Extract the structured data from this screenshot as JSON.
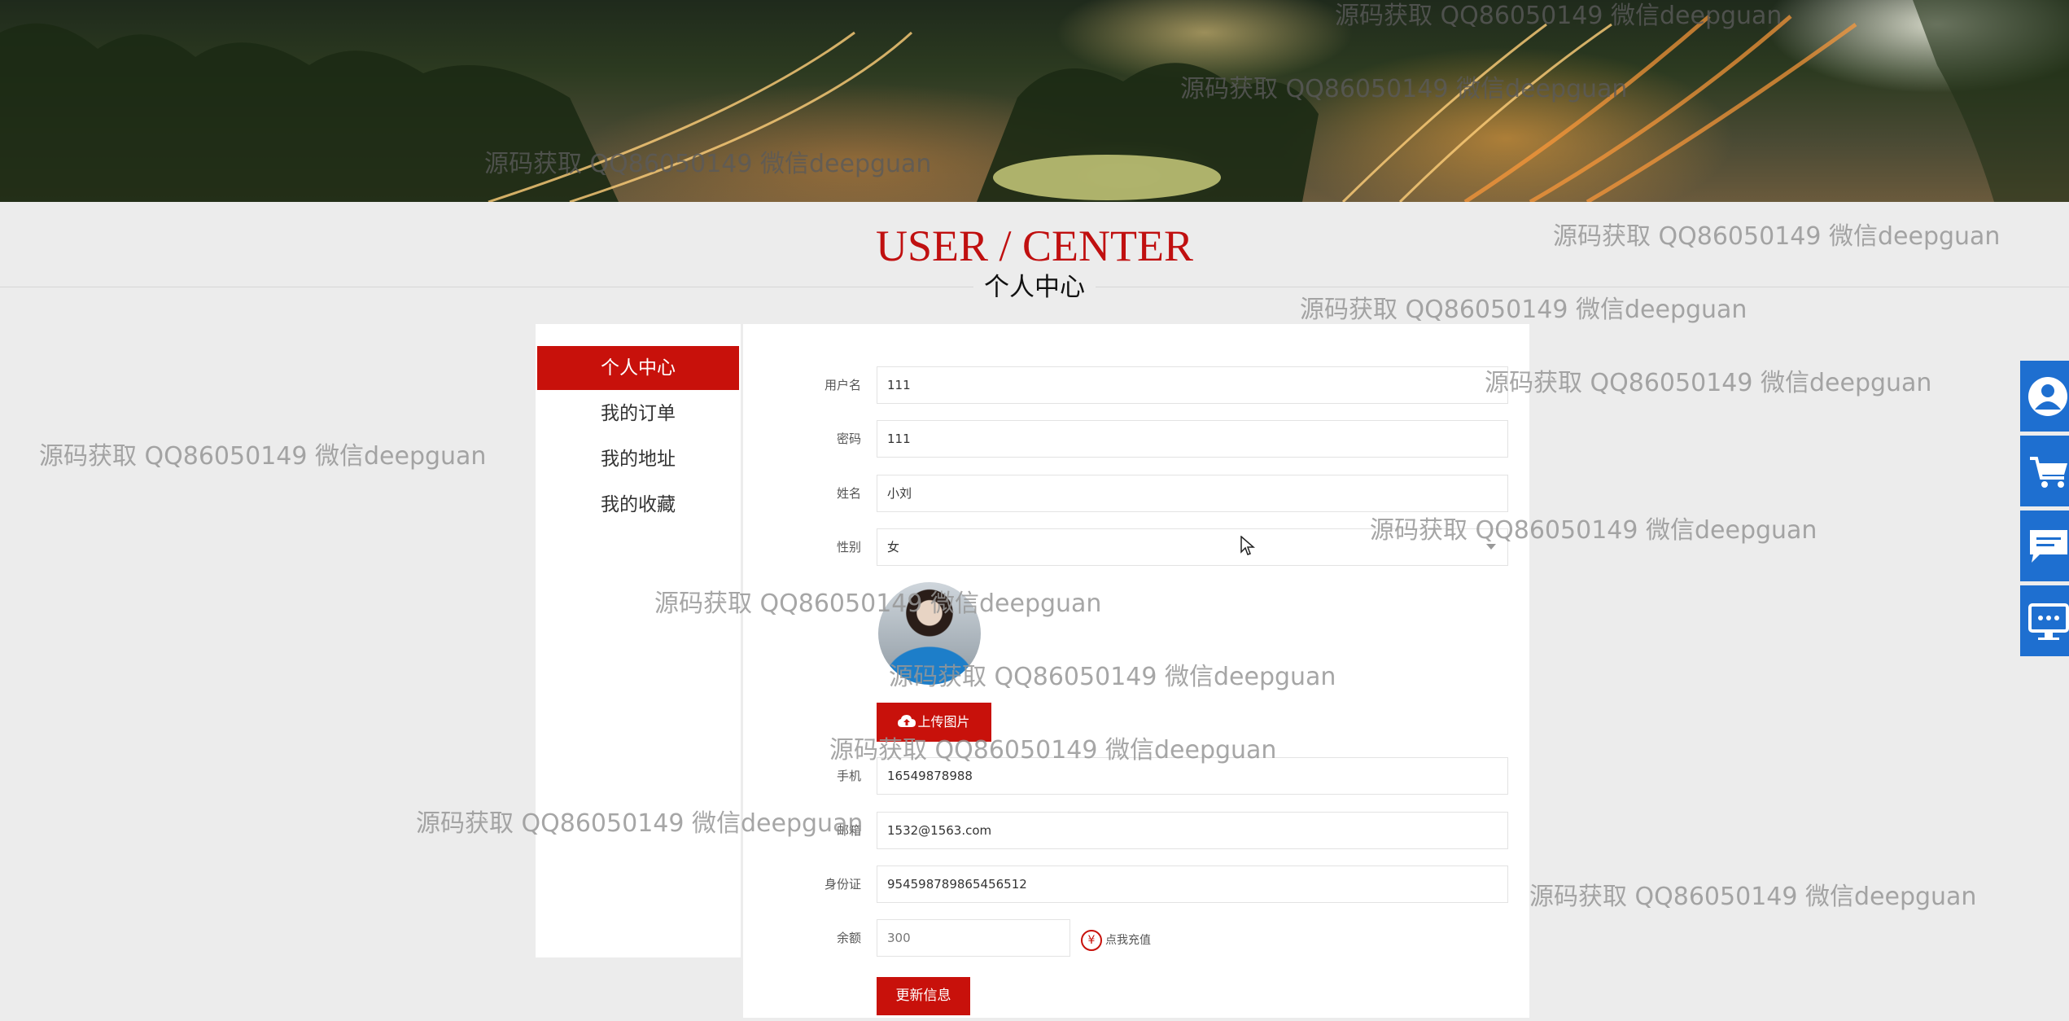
{
  "header": {
    "title_en": "USER / CENTER",
    "title_cn": "个人中心"
  },
  "menu": {
    "items": [
      {
        "label": "个人中心",
        "active": true
      },
      {
        "label": "我的订单"
      },
      {
        "label": "我的地址"
      },
      {
        "label": "我的收藏"
      }
    ]
  },
  "form": {
    "username_label": "用户名",
    "username": "111",
    "password_label": "密码",
    "password": "111",
    "name_label": "姓名",
    "name": "小刘",
    "gender_label": "性别",
    "gender": "女",
    "upload_label": "上传图片",
    "phone_label": "手机",
    "phone": "16549878988",
    "email_label": "邮箱",
    "email": "1532@1563.com",
    "idcard_label": "身份证",
    "idcard": "954598789865456512",
    "balance_label": "余额",
    "balance": "300",
    "recharge_label": "点我充值",
    "recharge_icon": "¥",
    "update_label": "更新信息"
  },
  "sidebar": [
    "user-icon",
    "cart-icon",
    "chat-icon",
    "service-icon"
  ],
  "watermark": "源码获取 QQ86050149 微信deepguan",
  "colors": {
    "accent": "#c8110b",
    "sidebar": "#1e6fd0",
    "background": "#ececec"
  }
}
